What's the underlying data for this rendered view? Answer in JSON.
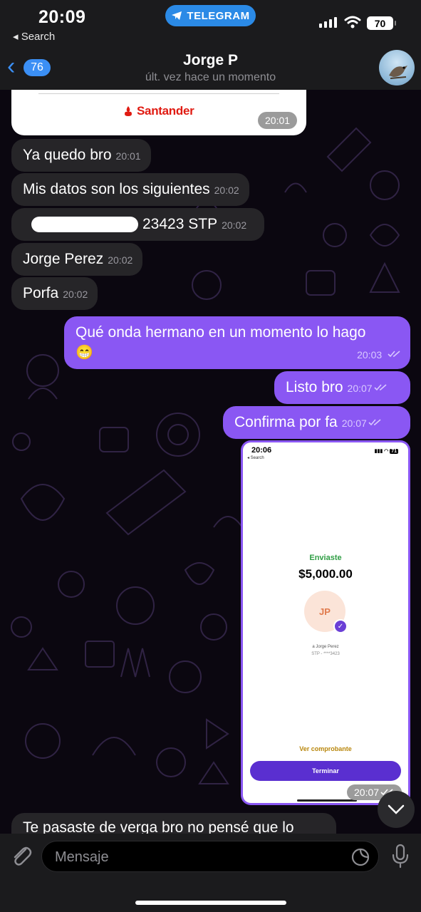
{
  "status_bar": {
    "time": "20:09",
    "back_app": "◂ Search",
    "app_pill": "TELEGRAM",
    "battery": "70"
  },
  "header": {
    "back_count": "76",
    "name": "Jorge P",
    "status": "últ. vez hace un momento"
  },
  "messages": {
    "santander": {
      "brand": "Santander",
      "time": "20:01"
    },
    "m1": {
      "text": "Ya quedo bro",
      "time": "20:01"
    },
    "m2": {
      "text": "Mis datos son los siguientes",
      "time": "20:02"
    },
    "m3": {
      "text": "23423 STP",
      "time": "20:02"
    },
    "m4": {
      "text": "Jorge Perez",
      "time": "20:02"
    },
    "m5": {
      "text": "Porfa",
      "time": "20:02"
    },
    "m6": {
      "text": "Qué onda hermano en un momento lo hago",
      "emoji": "😁",
      "time": "20:03"
    },
    "m7": {
      "text": "Listo bro",
      "time": "20:07"
    },
    "m8": {
      "text": "Confirma por fa",
      "time": "20:07"
    },
    "image": {
      "time": "20:07",
      "screen_time": "20:06",
      "screen_back": "◂ Search",
      "screen_battery": "71",
      "label": "Enviaste",
      "amount": "$5,000.00",
      "initials": "JP",
      "recipient": "a Jorge Perez",
      "account": "STP - ****3423",
      "link": "Ver comprobante",
      "button": "Terminar"
    },
    "m9": {
      "text": "Te pasaste de verga bro no pensé que lo"
    }
  },
  "input": {
    "placeholder": "Mensaje"
  },
  "colors": {
    "outgoing": "#8a57f3",
    "incoming": "#262528",
    "accent": "#3b8ff5",
    "brand_red": "#e01b12"
  }
}
